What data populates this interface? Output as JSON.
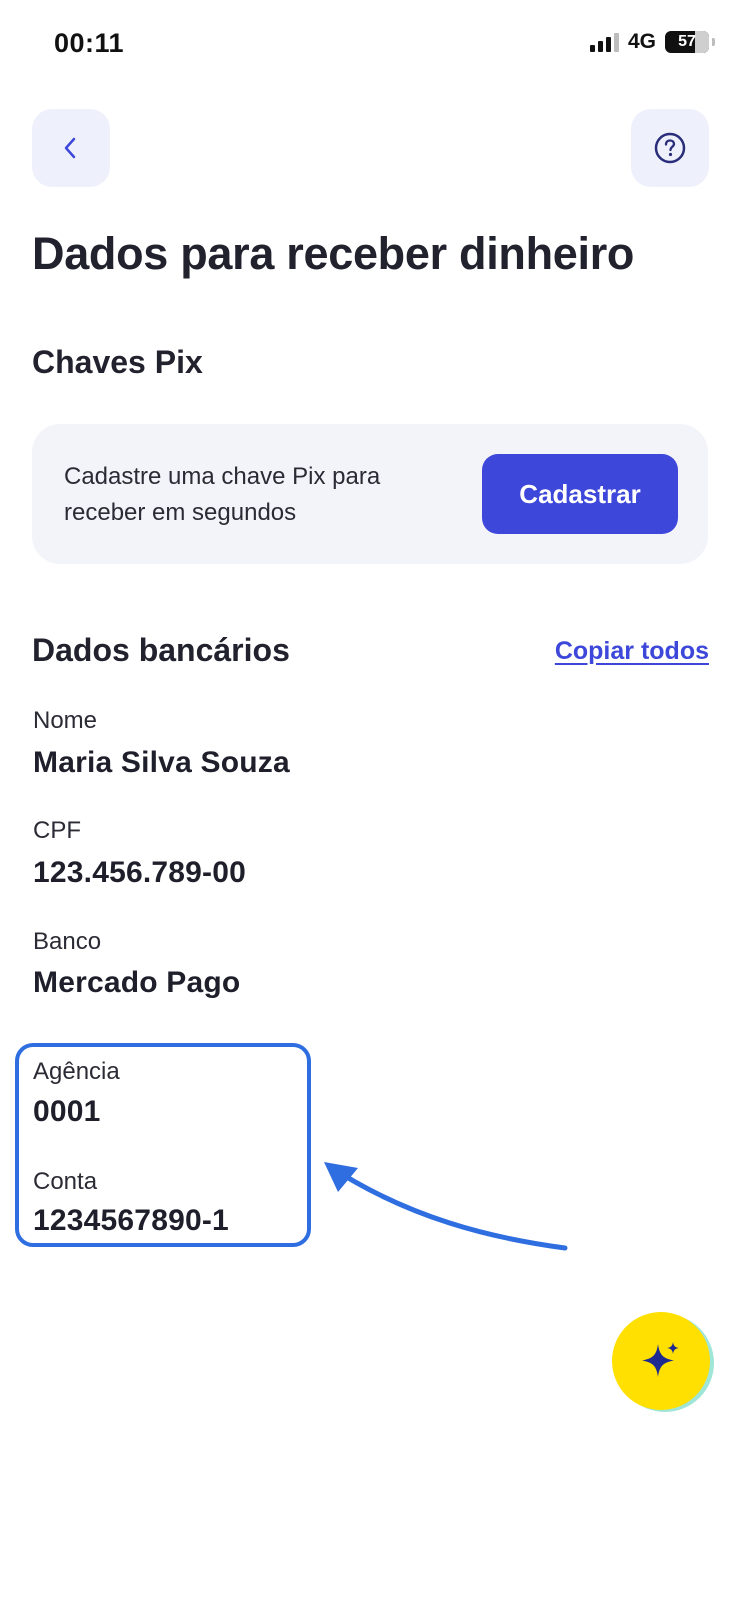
{
  "status_bar": {
    "time": "00:11",
    "network": "4G",
    "battery": "57"
  },
  "icons": {
    "back": "chevron-left-icon",
    "help": "question-circle-icon",
    "assistant": "sparkle-icon"
  },
  "header": {
    "title": "Dados para receber dinheiro"
  },
  "pix": {
    "section_title": "Chaves Pix",
    "card_text": "Cadastre uma chave Pix para receber em segundos",
    "button_label": "Cadastrar"
  },
  "bank": {
    "section_title": "Dados bancários",
    "copy_all_label": "Copiar todos",
    "fields": [
      {
        "label": "Nome",
        "value": "Maria Silva Souza"
      },
      {
        "label": "CPF",
        "value": "123.456.789-00"
      },
      {
        "label": "Banco",
        "value": "Mercado Pago"
      },
      {
        "label": "Agência",
        "value": "0001"
      },
      {
        "label": "Conta",
        "value": "1234567890-1"
      }
    ]
  },
  "colors": {
    "accent": "#3d47d9",
    "highlight": "#2f6ee0",
    "fab": "#ffe000",
    "card_bg": "#f3f4f9",
    "nav_bg": "#eef0fb"
  }
}
